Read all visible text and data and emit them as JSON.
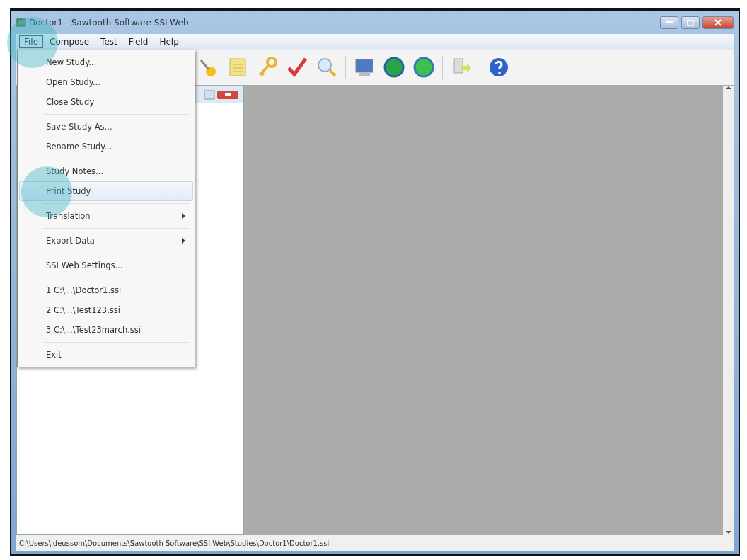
{
  "window": {
    "title": "Doctor1 - Sawtooth Software SSI Web"
  },
  "menu_bar": [
    {
      "label": "File",
      "selected": true
    },
    {
      "label": "Compose",
      "selected": false
    },
    {
      "label": "Test",
      "selected": false
    },
    {
      "label": "Field",
      "selected": false
    },
    {
      "label": "Help",
      "selected": false
    }
  ],
  "file_menu": [
    {
      "kind": "item",
      "label": "New Study...",
      "selected": false,
      "submenu": false
    },
    {
      "kind": "item",
      "label": "Open Study...",
      "selected": false,
      "submenu": false
    },
    {
      "kind": "item",
      "label": "Close Study",
      "selected": false,
      "submenu": false
    },
    {
      "kind": "separator"
    },
    {
      "kind": "item",
      "label": "Save Study As...",
      "selected": false,
      "submenu": false
    },
    {
      "kind": "item",
      "label": "Rename Study...",
      "selected": false,
      "submenu": false
    },
    {
      "kind": "separator"
    },
    {
      "kind": "item",
      "label": "Study Notes...",
      "selected": false,
      "submenu": false
    },
    {
      "kind": "item",
      "label": "Print Study",
      "selected": true,
      "submenu": false
    },
    {
      "kind": "separator"
    },
    {
      "kind": "item",
      "label": "Translation",
      "selected": false,
      "submenu": true
    },
    {
      "kind": "separator"
    },
    {
      "kind": "item",
      "label": "Export Data",
      "selected": false,
      "submenu": true
    },
    {
      "kind": "separator"
    },
    {
      "kind": "item",
      "label": "SSI Web Settings...",
      "selected": false,
      "submenu": false
    },
    {
      "kind": "separator"
    },
    {
      "kind": "item",
      "label": "1 C:\\...\\Doctor1.ssi",
      "selected": false,
      "submenu": false
    },
    {
      "kind": "item",
      "label": "2 C:\\...\\Test123.ssi",
      "selected": false,
      "submenu": false
    },
    {
      "kind": "item",
      "label": "3 C:\\...\\Test23march.ssi",
      "selected": false,
      "submenu": false
    },
    {
      "kind": "separator"
    },
    {
      "kind": "item",
      "label": "Exit",
      "selected": false,
      "submenu": false
    }
  ],
  "status_bar": {
    "path": "C:\\Users\\ideussom\\Documents\\Sawtooth Software\\SSI Web\\Studies\\Doctor1\\Doctor1.ssi"
  }
}
